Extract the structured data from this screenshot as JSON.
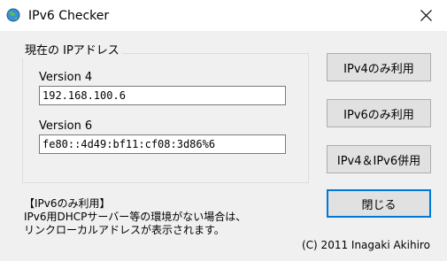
{
  "window": {
    "title": "IPv6 Checker"
  },
  "group": {
    "legend": "現在の IPアドレス",
    "v4_label": "Version 4",
    "v4_value": "192.168.100.6",
    "v6_label": "Version 6",
    "v6_value": "fe80::4d49:bf11:cf08:3d86%6"
  },
  "buttons": {
    "ipv4_only": "IPv4のみ利用",
    "ipv6_only": "IPv6のみ利用",
    "dual": "IPv4＆IPv6併用",
    "close": "閉じる"
  },
  "note": {
    "line1": "【IPv6のみ利用】",
    "line2": "IPv6用DHCPサーバー等の環境がない場合は、",
    "line3": "リンクローカルアドレスが表示されます。"
  },
  "copyright": "(C) 2011 Inagaki Akihiro",
  "icons": {
    "app": "globe-icon",
    "close": "close-icon"
  },
  "colors": {
    "default_button_border": "#0078d7",
    "button_face": "#e1e1e1",
    "window_bg": "#f0f0f0"
  }
}
